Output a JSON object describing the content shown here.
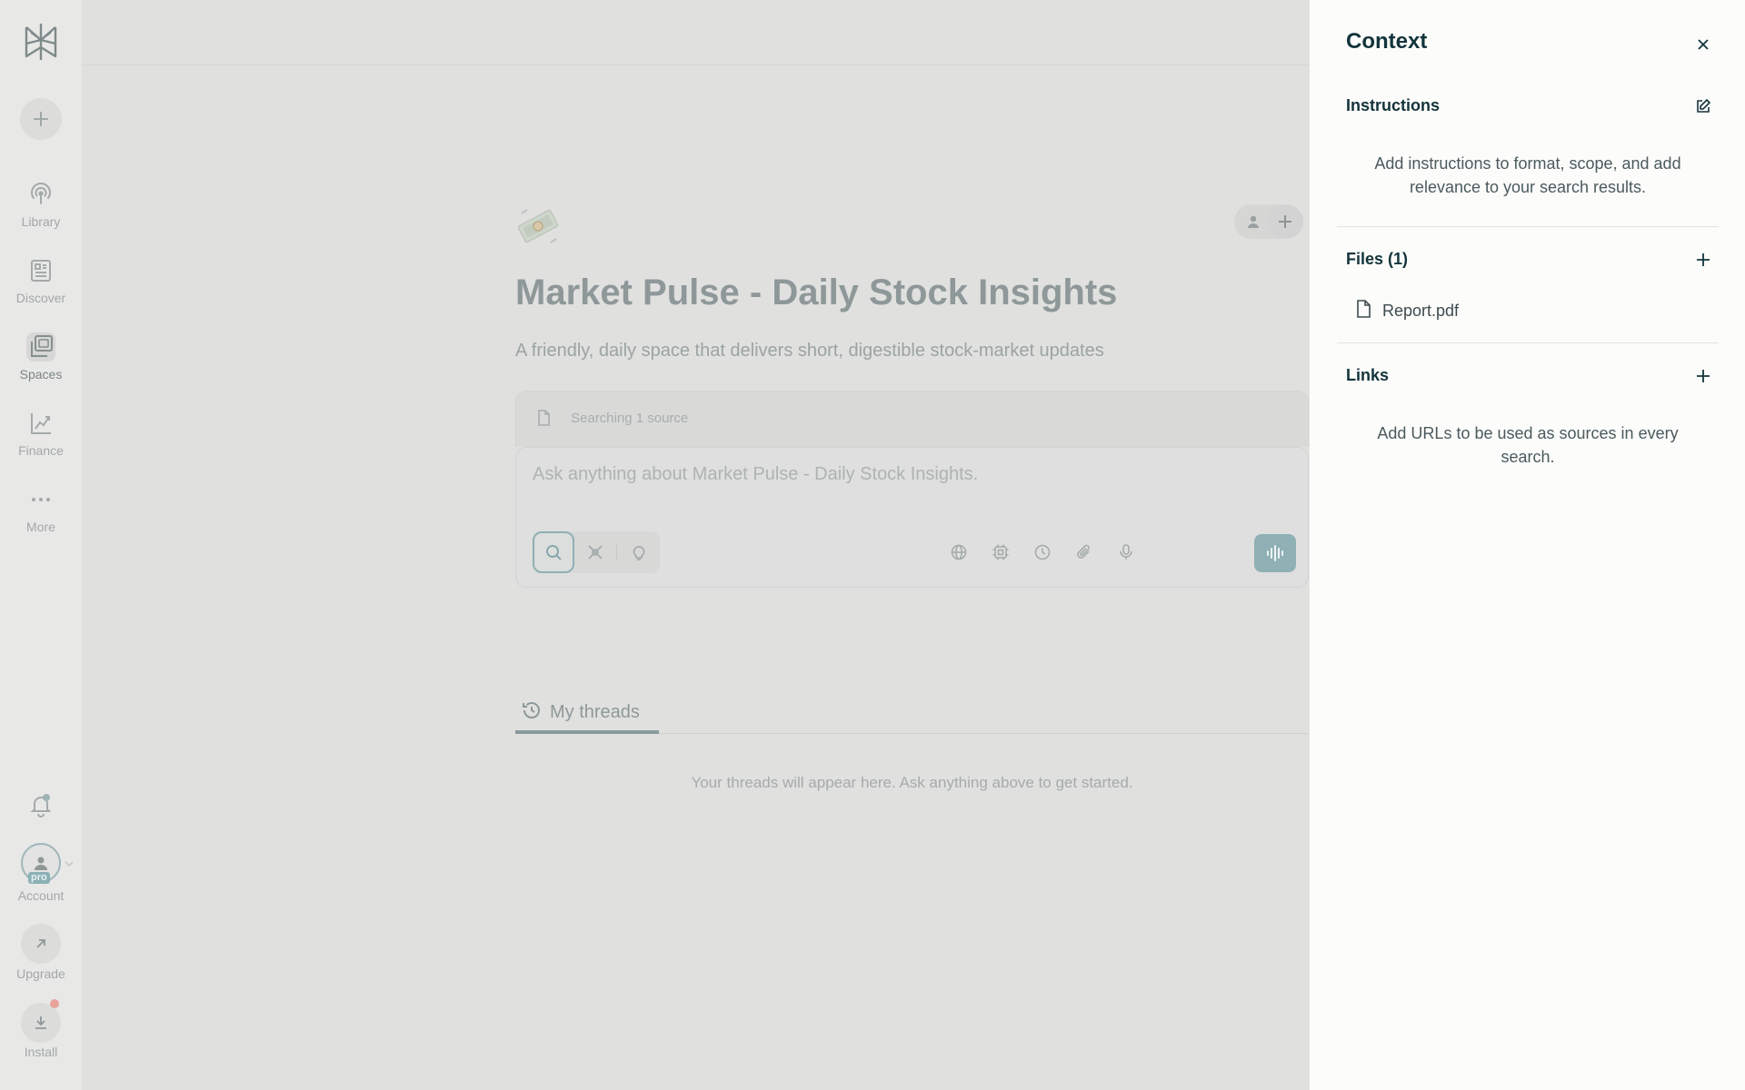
{
  "sidebar": {
    "items": [
      {
        "label": "Library",
        "icon": "library-icon"
      },
      {
        "label": "Discover",
        "icon": "discover-icon"
      },
      {
        "label": "Spaces",
        "icon": "spaces-icon"
      },
      {
        "label": "Finance",
        "icon": "finance-icon"
      },
      {
        "label": "More",
        "icon": "more-icon"
      }
    ],
    "active": "Spaces",
    "account_label": "Account",
    "pro_badge": "pro",
    "upgrade_label": "Upgrade",
    "install_label": "Install"
  },
  "space": {
    "title": "Market Pulse - Daily Stock Insights",
    "description": "A friendly, daily space that delivers short, digestible stock-market updates",
    "sources_text": "Searching 1 source",
    "ask_placeholder": "Ask anything about Market Pulse - Daily Stock Insights."
  },
  "tabs": {
    "threads_label": "My threads",
    "empty_message": "Your threads will appear here. Ask anything above to get started."
  },
  "context_panel": {
    "title": "Context",
    "instructions": {
      "title": "Instructions",
      "hint": "Add instructions to format, scope, and add relevance to your search results."
    },
    "files": {
      "title": "Files (1)",
      "items": [
        {
          "name": "Report.pdf"
        }
      ]
    },
    "links": {
      "title": "Links",
      "hint": "Add URLs to be used as sources in every search."
    }
  },
  "colors": {
    "accent": "#8fb0b4",
    "panel_bg": "#fcfcfa",
    "overlay_bg": "#e0e0df",
    "notification_dot": "#e8a49c"
  }
}
